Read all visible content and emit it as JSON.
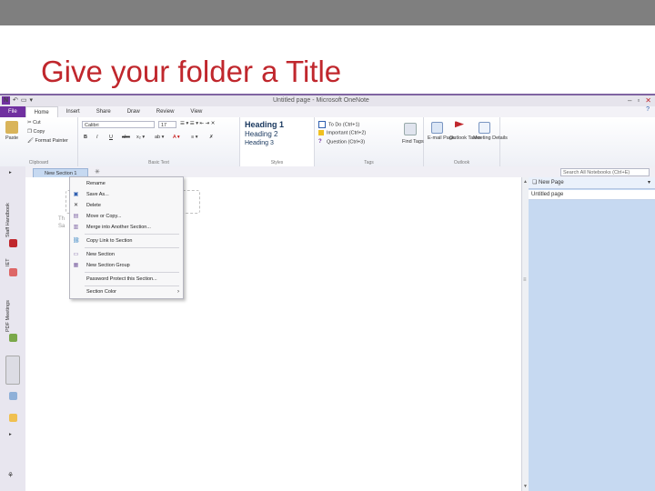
{
  "slide": {
    "title": "Give your folder a Title"
  },
  "window": {
    "title": "Untitled page - Microsoft OneNote",
    "logo": "N"
  },
  "ribbon_tabs": [
    "File",
    "Home",
    "Insert",
    "Share",
    "Draw",
    "Review",
    "View"
  ],
  "clipboard": {
    "paste": "Paste",
    "cut": "Cut",
    "copy": "Copy",
    "format_painter": "Format Painter",
    "label": "Clipboard"
  },
  "basic_text": {
    "font": "Calibri",
    "size": "17",
    "label": "Basic Text"
  },
  "styles": {
    "heading1": "Heading 1",
    "heading2": "Heading 2",
    "heading3": "Heading 3",
    "label": "Styles"
  },
  "tags": {
    "todo": "To Do (Ctrl+1)",
    "important": "Important (Ctrl+2)",
    "question": "Question (Ctrl+3)",
    "find_tags": "Find Tags",
    "label": "Tags"
  },
  "outlook": {
    "email_page": "E-mail Page",
    "outlook_tasks": "Outlook Tasks",
    "meeting_details": "Meeting Details",
    "label": "Outlook"
  },
  "notebooks": [
    "Staff Handbook",
    "IET",
    "PDF Meetings"
  ],
  "section": {
    "tab": "New Section 1"
  },
  "search": {
    "placeholder": "Search All Notebooks (Ctrl+E)"
  },
  "pages": {
    "new_page": "New Page",
    "items": [
      "Untitled page"
    ]
  },
  "context_menu": {
    "items": [
      {
        "label": "Rename"
      },
      {
        "label": "Save As..."
      },
      {
        "label": "Delete"
      },
      {
        "label": "Move or Copy..."
      },
      {
        "label": "Merge into Another Section..."
      },
      {
        "label": "Copy Link to Section"
      },
      {
        "label": "New Section"
      },
      {
        "label": "New Section Group"
      },
      {
        "label": "Password Protect this Section..."
      },
      {
        "label": "Section Color"
      }
    ]
  },
  "colors": {
    "title_red": "#c0272d",
    "onenote_purple": "#7030a0",
    "page_pane_blue": "#c6d9f1"
  }
}
